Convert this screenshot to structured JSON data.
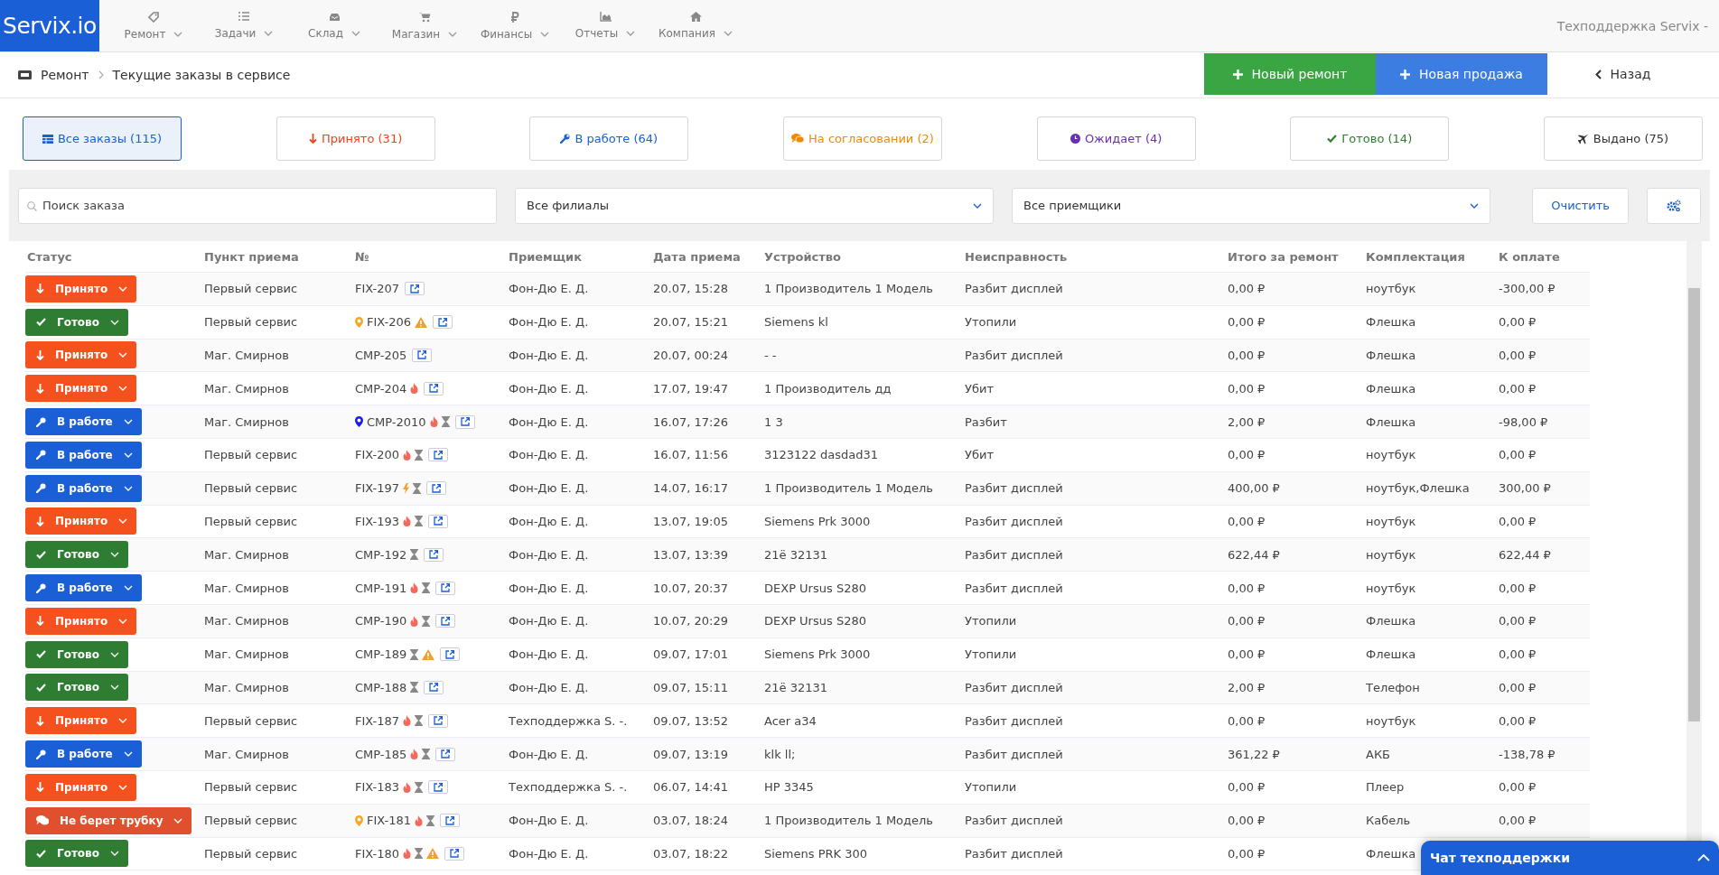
{
  "topnav": {
    "logo": "Servix.io",
    "items": [
      {
        "kind": "tag",
        "label": "Ремонт"
      },
      {
        "kind": "tasks",
        "label": "Задачи"
      },
      {
        "kind": "inbox",
        "label": "Склад"
      },
      {
        "kind": "cart",
        "label": "Магазин"
      },
      {
        "kind": "ruble",
        "label": "Финансы"
      },
      {
        "kind": "chart",
        "label": "Отчеты"
      },
      {
        "kind": "home",
        "label": "Компания"
      }
    ],
    "user": "Техподдержка Servix -"
  },
  "breadcrumbs": [
    "Ремонт",
    "Текущие заказы в сервисе"
  ],
  "actions": [
    {
      "kind": "new_repair",
      "label": "Новый ремонт"
    },
    {
      "kind": "new_sale",
      "label": "Новая продажа"
    },
    {
      "kind": "back",
      "label": "Назад"
    }
  ],
  "status_tabs": [
    {
      "kind": "all",
      "label": "Все заказы (115)",
      "selected": true
    },
    {
      "kind": "accepted",
      "label": "Принято (31)",
      "selected": false
    },
    {
      "kind": "in_work",
      "label": "В работе (64)",
      "selected": false
    },
    {
      "kind": "discuss",
      "label": "На согласовании (2)",
      "selected": false
    },
    {
      "kind": "waiting",
      "label": "Ожидает (4)",
      "selected": false
    },
    {
      "kind": "ready",
      "label": "Готово (14)",
      "selected": false
    },
    {
      "kind": "issued",
      "label": "Выдано (75)",
      "selected": false
    }
  ],
  "filters": {
    "search": {
      "placeholder": "Поиск заказа"
    },
    "branch": "Все филиалы",
    "receiver": "Все приемщики",
    "clear": "Очистить"
  },
  "table": {
    "columns": [
      "Статус",
      "Пункт приема",
      "№",
      "Приемщик",
      "Дата приема",
      "Устройство",
      "Неисправность",
      "Итого за ремонт",
      "Комплектация",
      "К оплате"
    ],
    "rows": [
      {
        "status": {
          "kind": "accepted",
          "label": "Принято"
        },
        "point": "Первый сервис",
        "number": "FIX-207",
        "icons": [],
        "receiver": "Фон-Дю Е. Д.",
        "date": "20.07, 15:28",
        "device": "1 Производитель 1 Модель",
        "fault": "Разбит дисплей",
        "total": "0,00 ₽",
        "kit": "ноутбук",
        "to_pay": "-300,00 ₽"
      },
      {
        "status": {
          "kind": "ready",
          "label": "Готово"
        },
        "point": "Первый сервис",
        "pin": {
          "color": "#f5a623"
        },
        "number": "FIX-206",
        "icons": [
          {
            "kind": "warning"
          }
        ],
        "receiver": "Фон-Дю Е. Д.",
        "date": "20.07, 15:21",
        "device": "Siemens kl",
        "fault": "Утопили",
        "total": "0,00 ₽",
        "kit": "Флешка",
        "to_pay": "0,00 ₽"
      },
      {
        "status": {
          "kind": "accepted",
          "label": "Принято"
        },
        "point": "Маг. Смирнов",
        "number": "CMP-205",
        "icons": [],
        "receiver": "Фон-Дю Е. Д.",
        "date": "20.07, 00:24",
        "device": "- -",
        "fault": "Разбит дисплей",
        "total": "0,00 ₽",
        "kit": "Флешка",
        "to_pay": "0,00 ₽"
      },
      {
        "status": {
          "kind": "accepted",
          "label": "Принято"
        },
        "point": "Маг. Смирнов",
        "number": "CMP-204",
        "icons": [
          {
            "kind": "fire"
          }
        ],
        "receiver": "Фон-Дю Е. Д.",
        "date": "17.07, 19:47",
        "device": "1 Производитель дд",
        "fault": "Убит",
        "total": "0,00 ₽",
        "kit": "Флешка",
        "to_pay": "0,00 ₽"
      },
      {
        "status": {
          "kind": "in_work",
          "label": "В работе"
        },
        "point": "Маг. Смирнов",
        "pin": {
          "color": "#1a1aee"
        },
        "number": "CMP-2010",
        "icons": [
          {
            "kind": "fire"
          },
          {
            "kind": "hourglass"
          }
        ],
        "receiver": "Фон-Дю Е. Д.",
        "date": "16.07, 17:26",
        "device": "1 3",
        "fault": "Разбит",
        "total": "2,00 ₽",
        "kit": "Флешка",
        "to_pay": "-98,00 ₽"
      },
      {
        "status": {
          "kind": "in_work",
          "label": "В работе"
        },
        "point": "Первый сервис",
        "number": "FIX-200",
        "icons": [
          {
            "kind": "fire"
          },
          {
            "kind": "hourglass"
          }
        ],
        "receiver": "Фон-Дю Е. Д.",
        "date": "16.07, 11:56",
        "device": "3123122 dasdad31",
        "fault": "Убит",
        "total": "0,00 ₽",
        "kit": "ноутбук",
        "to_pay": "0,00 ₽"
      },
      {
        "status": {
          "kind": "in_work",
          "label": "В работе"
        },
        "point": "Первый сервис",
        "number": "FIX-197",
        "icons": [
          {
            "kind": "bolt"
          },
          {
            "kind": "hourglass"
          }
        ],
        "receiver": "Фон-Дю Е. Д.",
        "date": "14.07, 16:17",
        "device": "1 Производитель 1 Модель",
        "fault": "Разбит дисплей",
        "total": "400,00 ₽",
        "kit": "ноутбук,Флешка",
        "to_pay": "300,00 ₽"
      },
      {
        "status": {
          "kind": "accepted",
          "label": "Принято"
        },
        "point": "Первый сервис",
        "number": "FIX-193",
        "icons": [
          {
            "kind": "fire"
          },
          {
            "kind": "hourglass"
          }
        ],
        "receiver": "Фон-Дю Е. Д.",
        "date": "13.07, 19:05",
        "device": "Siemens Prk 3000",
        "fault": "Разбит дисплей",
        "total": "0,00 ₽",
        "kit": "ноутбук",
        "to_pay": "0,00 ₽"
      },
      {
        "status": {
          "kind": "ready",
          "label": "Готово"
        },
        "point": "Маг. Смирнов",
        "number": "CMP-192",
        "icons": [
          {
            "kind": "hourglass"
          }
        ],
        "receiver": "Фон-Дю Е. Д.",
        "date": "13.07, 13:39",
        "device": "21ё 32131",
        "fault": "Разбит дисплей",
        "total": "622,44 ₽",
        "kit": "ноутбук",
        "to_pay": "622,44 ₽"
      },
      {
        "status": {
          "kind": "in_work",
          "label": "В работе"
        },
        "point": "Маг. Смирнов",
        "number": "CMP-191",
        "icons": [
          {
            "kind": "fire"
          },
          {
            "kind": "hourglass"
          }
        ],
        "receiver": "Фон-Дю Е. Д.",
        "date": "10.07, 20:37",
        "device": "DEXP Ursus S280",
        "fault": "Разбит дисплей",
        "total": "0,00 ₽",
        "kit": "ноутбук",
        "to_pay": "0,00 ₽"
      },
      {
        "status": {
          "kind": "accepted",
          "label": "Принято"
        },
        "point": "Маг. Смирнов",
        "number": "CMP-190",
        "icons": [
          {
            "kind": "fire"
          },
          {
            "kind": "hourglass"
          }
        ],
        "receiver": "Фон-Дю Е. Д.",
        "date": "10.07, 20:29",
        "device": "DEXP Ursus S280",
        "fault": "Утопили",
        "total": "0,00 ₽",
        "kit": "Флешка",
        "to_pay": "0,00 ₽"
      },
      {
        "status": {
          "kind": "ready",
          "label": "Готово"
        },
        "point": "Маг. Смирнов",
        "number": "CMP-189",
        "icons": [
          {
            "kind": "hourglass"
          },
          {
            "kind": "warning"
          }
        ],
        "receiver": "Фон-Дю Е. Д.",
        "date": "09.07, 17:01",
        "device": "Siemens Prk 3000",
        "fault": "Утопили",
        "total": "0,00 ₽",
        "kit": "Флешка",
        "to_pay": "0,00 ₽"
      },
      {
        "status": {
          "kind": "ready",
          "label": "Готово"
        },
        "point": "Маг. Смирнов",
        "number": "CMP-188",
        "icons": [
          {
            "kind": "hourglass"
          }
        ],
        "receiver": "Фон-Дю Е. Д.",
        "date": "09.07, 15:11",
        "device": "21ё 32131",
        "fault": "Разбит дисплей",
        "total": "2,00 ₽",
        "kit": "Телефон",
        "to_pay": "0,00 ₽"
      },
      {
        "status": {
          "kind": "accepted",
          "label": "Принято"
        },
        "point": "Первый сервис",
        "number": "FIX-187",
        "icons": [
          {
            "kind": "fire"
          },
          {
            "kind": "hourglass"
          }
        ],
        "receiver": "Техподдержка S. -.",
        "date": "09.07, 13:52",
        "device": "Acer a34",
        "fault": "Разбит дисплей",
        "total": "0,00 ₽",
        "kit": "ноутбук",
        "to_pay": "0,00 ₽"
      },
      {
        "status": {
          "kind": "in_work",
          "label": "В работе"
        },
        "point": "Маг. Смирнов",
        "number": "CMP-185",
        "icons": [
          {
            "kind": "fire"
          },
          {
            "kind": "hourglass"
          }
        ],
        "receiver": "Фон-Дю Е. Д.",
        "date": "09.07, 13:19",
        "device": "klk ll;",
        "fault": "Разбит дисплей",
        "total": "361,22 ₽",
        "kit": "АКБ",
        "to_pay": "-138,78 ₽"
      },
      {
        "status": {
          "kind": "accepted",
          "label": "Принято"
        },
        "point": "Первый сервис",
        "number": "FIX-183",
        "icons": [
          {
            "kind": "fire"
          },
          {
            "kind": "hourglass"
          }
        ],
        "receiver": "Техподдержка S. -.",
        "date": "06.07, 14:41",
        "device": "HP 3345",
        "fault": "Утопили",
        "total": "0,00 ₽",
        "kit": "Плеер",
        "to_pay": "0,00 ₽"
      },
      {
        "status": {
          "kind": "no_answer",
          "label": "Не берет трубку"
        },
        "point": "Первый сервис",
        "pin": {
          "color": "#f5a623"
        },
        "number": "FIX-181",
        "icons": [
          {
            "kind": "fire"
          },
          {
            "kind": "hourglass"
          }
        ],
        "receiver": "Фон-Дю Е. Д.",
        "date": "03.07, 18:24",
        "device": "1 Производитель 1 Модель",
        "fault": "Разбит дисплей",
        "total": "0,00 ₽",
        "kit": "Кабель",
        "to_pay": "0,00 ₽"
      },
      {
        "status": {
          "kind": "ready",
          "label": "Готово"
        },
        "point": "Первый сервис",
        "number": "FIX-180",
        "icons": [
          {
            "kind": "fire"
          },
          {
            "kind": "hourglass"
          },
          {
            "kind": "warning"
          }
        ],
        "receiver": "Фон-Дю Е. Д.",
        "date": "03.07, 18:22",
        "device": "Siemens PRK 300",
        "fault": "Разбит дисплей",
        "total": "0,00 ₽",
        "kit": "Флешка"
      }
    ]
  },
  "chat": {
    "title": "Чат техподдержки"
  }
}
